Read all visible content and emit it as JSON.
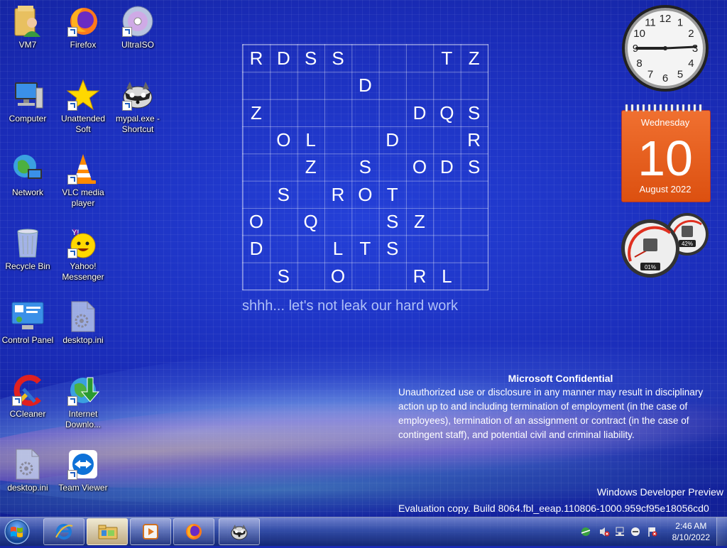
{
  "desktop_icons": [
    {
      "id": "vm7",
      "label": "VM7",
      "icon": "user-folder-icon",
      "shortcut": false
    },
    {
      "id": "firefox",
      "label": "Firefox",
      "icon": "firefox-icon",
      "shortcut": true
    },
    {
      "id": "ultraiso",
      "label": "UltraISO",
      "icon": "disc-icon",
      "shortcut": true
    },
    {
      "id": "computer",
      "label": "Computer",
      "icon": "computer-icon",
      "shortcut": false
    },
    {
      "id": "unattended",
      "label": "Unattended Soft",
      "icon": "star-icon",
      "shortcut": true
    },
    {
      "id": "mypal",
      "label": "mypal.exe - Shortcut",
      "icon": "raccoon-icon",
      "shortcut": true
    },
    {
      "id": "network",
      "label": "Network",
      "icon": "network-icon",
      "shortcut": false
    },
    {
      "id": "vlc",
      "label": "VLC media player",
      "icon": "traffic-cone-icon",
      "shortcut": true
    },
    {
      "id": "recycle",
      "label": "Recycle Bin",
      "icon": "recycle-bin-icon",
      "shortcut": false
    },
    {
      "id": "yahoo",
      "label": "Yahoo! Messenger",
      "icon": "smiley-icon",
      "shortcut": true
    },
    {
      "id": "control",
      "label": "Control Panel",
      "icon": "control-panel-icon",
      "shortcut": false
    },
    {
      "id": "desktopini1",
      "label": "desktop.ini",
      "icon": "settings-file-icon",
      "shortcut": false
    },
    {
      "id": "ccleaner",
      "label": "CCleaner",
      "icon": "ccleaner-icon",
      "shortcut": true
    },
    {
      "id": "idm",
      "label": "Internet Downlo...",
      "icon": "download-globe-icon",
      "shortcut": true
    },
    {
      "id": "desktopini2",
      "label": "desktop.ini",
      "icon": "settings-file-icon",
      "shortcut": false
    },
    {
      "id": "teamviewer",
      "label": "Team Viewer",
      "icon": "teamviewer-icon",
      "shortcut": true
    }
  ],
  "puzzle": {
    "rows": [
      [
        "R",
        "D",
        "S",
        "S",
        "",
        "",
        "",
        "T",
        "Z"
      ],
      [
        "",
        "",
        "",
        "",
        "D",
        "",
        "",
        "",
        ""
      ],
      [
        "Z",
        "",
        "",
        "",
        "",
        "",
        "D",
        "Q",
        "S"
      ],
      [
        "",
        "O",
        "L",
        "",
        "",
        "D",
        "",
        "",
        "R"
      ],
      [
        "",
        "",
        "Z",
        "",
        "S",
        "",
        "O",
        "D",
        "S"
      ],
      [
        "",
        "S",
        "",
        "R",
        "O",
        "T",
        "",
        "",
        ""
      ],
      [
        "O",
        "",
        "Q",
        "",
        "",
        "S",
        "Z",
        "",
        ""
      ],
      [
        "D",
        "",
        "",
        "L",
        "T",
        "S",
        "",
        "",
        ""
      ],
      [
        "",
        "S",
        "",
        "O",
        "",
        "",
        "R",
        "L",
        ""
      ]
    ],
    "tagline": "shhh... let's not leak our hard work"
  },
  "watermark": {
    "title": "Microsoft Confidential",
    "body": "Unauthorized use or disclosure in any manner may result in disciplinary action up to and including termination of employment (in the case of employees), termination of an assignment or contract (in the case of contingent staff), and potential civil and criminal liability.",
    "product": "Windows Developer Preview",
    "build": "Evaluation copy. Build 8064.fbl_eeap.110806-1000.959cf95e18056cd0"
  },
  "gadgets": {
    "clock": {
      "numerals": [
        "12",
        "1",
        "2",
        "3",
        "4",
        "5",
        "6",
        "7",
        "8",
        "9",
        "10",
        "11"
      ],
      "time": "2:46"
    },
    "calendar": {
      "weekday": "Wednesday",
      "day": "10",
      "month_year": "August 2022"
    },
    "cpu_meter": {
      "cpu_percent": "01%",
      "memory_percent": "42%"
    }
  },
  "taskbar": {
    "buttons": [
      {
        "id": "ie",
        "icon": "internet-explorer-icon"
      },
      {
        "id": "explorer",
        "icon": "folder-icon",
        "active": true
      },
      {
        "id": "media",
        "icon": "media-player-icon"
      },
      {
        "id": "firefox",
        "icon": "firefox-icon"
      },
      {
        "id": "mypal",
        "icon": "raccoon-icon"
      }
    ],
    "time": "2:46 AM",
    "date": "8/10/2022"
  }
}
